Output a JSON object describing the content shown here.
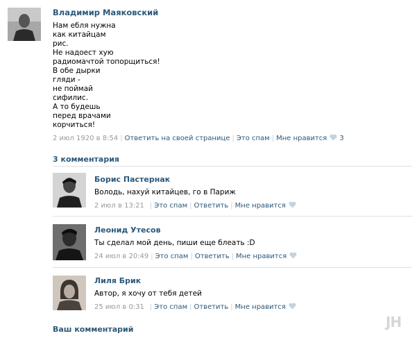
{
  "post": {
    "author": "Владимир Маяковский",
    "lines": [
      "Нам ебля нужна",
      "как китайцам",
      "рис.",
      "Не надоест хую",
      "радиомачтой топорщиться!",
      "В обе дырки",
      "гляди -",
      "не поймай",
      "сифилис.",
      "А то будешь",
      "перед врачами",
      "корчиться!"
    ],
    "date": "2 июл 1920 в 8:54",
    "reply_label": "Ответить на своей странице",
    "spam_label": "Это спам",
    "dislike_label": "Мне нравится",
    "like_count": "3"
  },
  "comments_header": "3 комментария",
  "comments": [
    {
      "author": "Борис Пастернак",
      "text": "Володь, нахуй китайцев, го в Париж",
      "date": "2 июл в 13:21",
      "spam_label": "Это спам",
      "reply_label": "Ответить",
      "like_label": "Мне нравится"
    },
    {
      "author": "Леонид Утесов",
      "text": "Ты сделал мой день, пиши еще блеать :D",
      "date": "24 июл в 20:49",
      "spam_label": "Это спам",
      "reply_label": "Ответить",
      "like_label": "Мне нравится"
    },
    {
      "author": "Лиля Брик",
      "text": "Автор, я хочу от тебя детей",
      "date": "25 июл в 0:31",
      "spam_label": "Это спам",
      "reply_label": "Ответить",
      "like_label": "Мне нравится"
    }
  ],
  "your_comment_label": "Ваш комментарий",
  "watermark": "JH",
  "colors": {
    "link": "#2b587a",
    "meta": "#999999",
    "separator": "#c6ced8",
    "heart": "#c5d2df",
    "divider": "#dae1e8"
  },
  "icons": {
    "like": "heart-icon"
  }
}
